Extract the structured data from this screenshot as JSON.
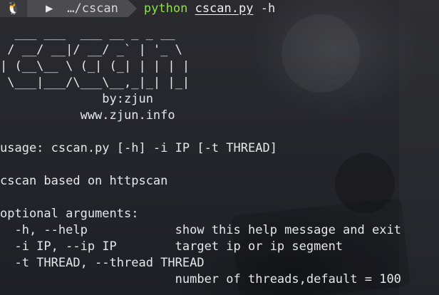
{
  "prompt": {
    "os_icon": "🐧",
    "dir_icon": "▶",
    "dir": "…/cscan",
    "command_program": "python",
    "command_file": "cscan.py",
    "command_args": "-h"
  },
  "output": {
    "banner_lines": [
      "  ___ ___  ___ __ _ _ __  ",
      " / __/ __|/ __/ _` | '_ \\ ",
      "| (__\\__ \\ (_| (_| | | | |",
      " \\___|___/\\___\\__,_|_| |_|"
    ],
    "credit_line": "              by:zjun",
    "site_line": "           www.zjun.info",
    "blank": "",
    "usage_line": "usage: cscan.py [-h] -i IP [-t THREAD]",
    "description_line": "cscan based on httpscan",
    "optional_header": "optional arguments:",
    "args": [
      "  -h, --help            show this help message and exit",
      "  -i IP, --ip IP        target ip or ip segment",
      "  -t THREAD, --thread THREAD",
      "                        number of threads,default = 100"
    ]
  },
  "colors": {
    "command_green": "#8ee04e",
    "segment_os": "#3b3b3f",
    "segment_dir": "#4b4b50",
    "text": "#e7e7ea"
  }
}
